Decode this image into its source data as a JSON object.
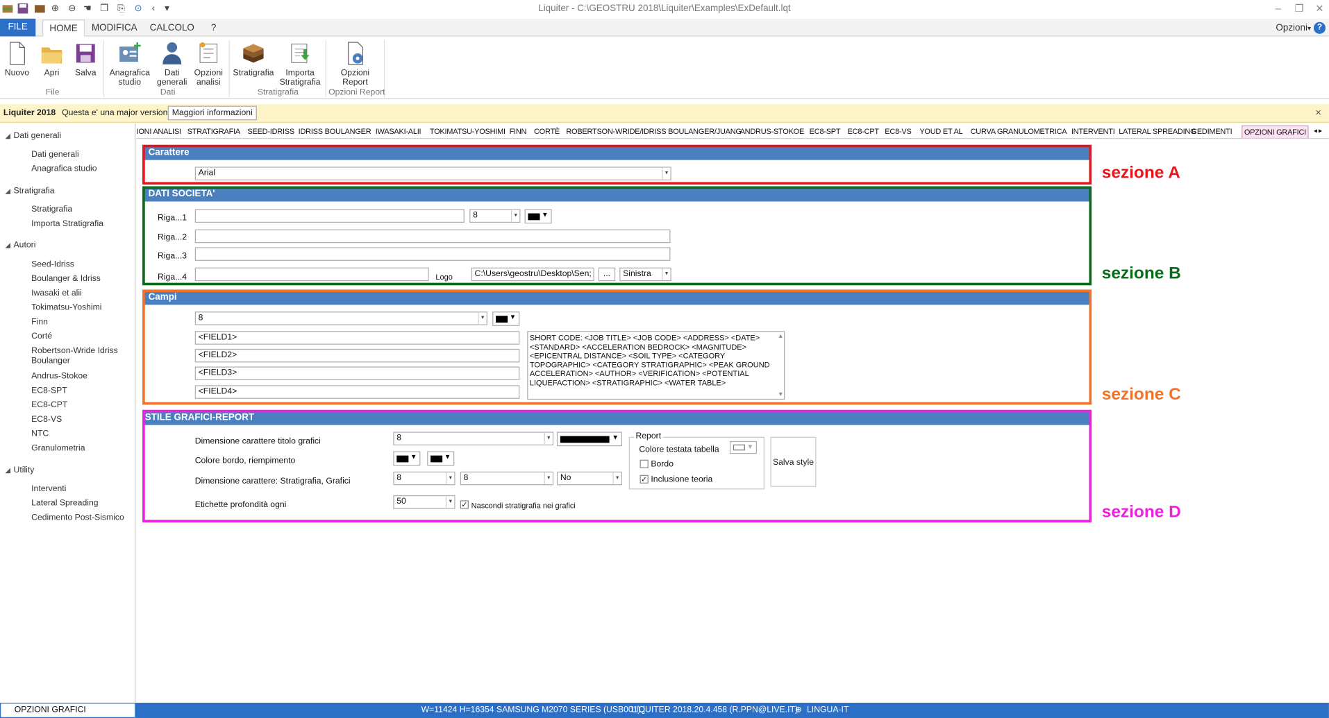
{
  "window": {
    "title": "Liquiter - C:\\GEOSTRU 2018\\Liquiter\\Examples\\ExDefault.lqt",
    "min": "‒",
    "restore": "❐",
    "close": "✕",
    "options": "Opzioni",
    "help": "?"
  },
  "ribbon_tabs": [
    "FILE",
    "HOME",
    "MODIFICA",
    "CALCOLO",
    "?"
  ],
  "ribbon": {
    "buttons": [
      "Nuovo",
      "Apri",
      "Salva",
      "Anagrafica\nstudio",
      "Dati\ngenerali",
      "Opzioni\nanalisi",
      "Stratigrafia",
      "Importa\nStratigrafia",
      "Opzioni\nReport"
    ],
    "groups": [
      "File",
      "Dati",
      "Stratigrafia",
      "Opzioni Report"
    ]
  },
  "infobar": {
    "product": "Liquiter 2018",
    "message": "Questa e' una major version",
    "button": "Maggiori informazioni",
    "close": "×"
  },
  "nav": [
    {
      "category": "Dati generali",
      "items": [
        "Dati generali",
        "Anagrafica studio"
      ]
    },
    {
      "category": "Stratigrafia",
      "items": [
        "Stratigrafia",
        "Importa Stratigrafia"
      ]
    },
    {
      "category": "Autori",
      "items": [
        "Seed-Idriss",
        "Boulanger & Idriss",
        "Iwasaki et alii",
        "Tokimatsu-Yoshimi",
        "Finn",
        "Corté",
        "Robertson-Wride Idriss Boulanger",
        "Andrus-Stokoe",
        "EC8-SPT",
        "EC8-CPT",
        "EC8-VS",
        "NTC",
        "Granulometria"
      ]
    },
    {
      "category": "Utility",
      "items": [
        "Interventi",
        "Lateral Spreading",
        "Cedimento Post-Sismico"
      ]
    }
  ],
  "page_tabs": [
    "IONI ANALISI",
    "STRATIGRAFIA",
    "SEED-IDRISS",
    "IDRISS BOULANGER",
    "IWASAKI-ALII",
    "TOKIMATSU-YOSHIMI",
    "FINN",
    "CORTÈ",
    "ROBERTSON-WRIDE/IDRISS BOULANGER/JUANG",
    "ANDRUS-STOKOE",
    "EC8-SPT",
    "EC8-CPT",
    "EC8-VS",
    "YOUD ET AL",
    "CURVA GRANULOMETRICA",
    "INTERVENTI",
    "LATERAL SPREADING",
    "CEDIMENTI",
    "OPZIONI GRAFICI"
  ],
  "page_tab_nav": "◂ ▸",
  "carattere": {
    "title": "Carattere",
    "font": "Arial",
    "section_label": "sezione A"
  },
  "societa": {
    "title": "DATI SOCIETA'",
    "rows": [
      "Riga...1",
      "Riga...2",
      "Riga...3",
      "Riga...4"
    ],
    "size": "8",
    "logo_label": "Logo",
    "logo_path": "C:\\Users\\geostru\\Desktop\\Sen;",
    "browse": "...",
    "align": "Sinistra",
    "section_label": "sezione B"
  },
  "campi": {
    "title": "Campi",
    "size": "8",
    "fields": [
      "<FIELD1>",
      "<FIELD2>",
      "<FIELD3>",
      "<FIELD4>"
    ],
    "codes": "SHORT CODE:  <JOB TITLE>  <JOB CODE>  <ADDRESS>  <DATE>  <STANDARD>  <ACCELERATION BEDROCK>  <MAGNITUDE>  <EPICENTRAL DISTANCE>  <SOIL TYPE>  <CATEGORY TOPOGRAPHIC>  <CATEGORY STRATIGRAPHIC>  <PEAK GROUND ACCELERATION>  <AUTHOR>  <VERIFICATION>  <POTENTIAL LIQUEFACTION>  <STRATIGRAPHIC>  <WATER TABLE>",
    "section_label": "sezione C"
  },
  "stile": {
    "title": "STILE GRAFICI-REPORT",
    "dim_titolo_label": "Dimensione carattere titolo grafici",
    "dim_titolo": "8",
    "colore_label": "Colore bordo, riempimento",
    "dim_strat_label": "Dimensione carattere: Stratigrafia, Grafici",
    "dim_strat": "8",
    "dim_grafici": "8",
    "option_no": "No",
    "etichette_label": "Etichette profondità ogni",
    "etichette": "50",
    "nascondi": "Nascondi stratigrafia nei grafici",
    "report_legend": "Report",
    "colore_testata": "Colore testata tabella",
    "bordo": "Bordo",
    "inclusione": "Inclusione teoria",
    "salva": "Salva style",
    "section_label": "sezione D"
  },
  "status": {
    "left": "OPZIONI GRAFICI",
    "printer": "W=11424 H=16354 SAMSUNG M2070 SERIES (USB001)  |",
    "version": "LIQUITER 2018.20.4.458 (R.PPN@LIVE.IT)",
    "lang": "LINGUA-IT"
  },
  "colors": {
    "accent": "#2b70c6",
    "panel_header": "#4a80bf",
    "section_a": "#e8151b",
    "section_b": "#0a6b1a",
    "section_c": "#f0752b",
    "section_d": "#ee22dd"
  }
}
